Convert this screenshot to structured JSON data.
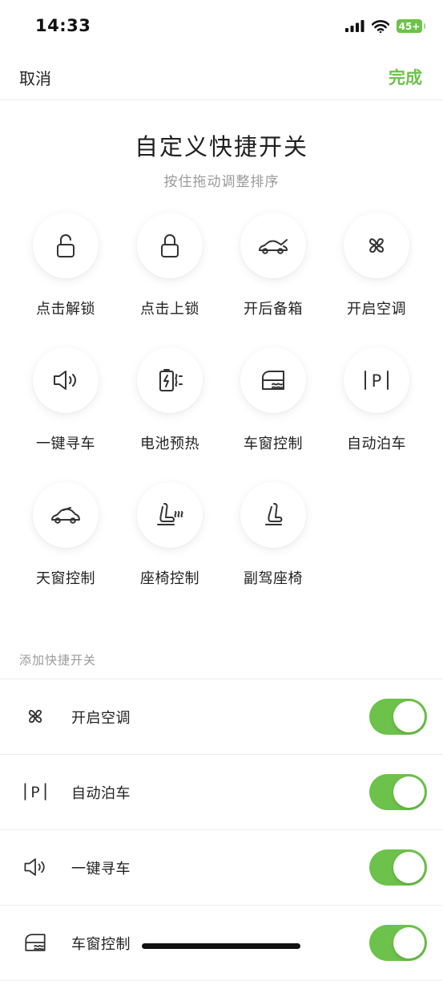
{
  "status_bar": {
    "time": "14:33",
    "battery": "45+"
  },
  "nav": {
    "cancel_label": "取消",
    "done_label": "完成"
  },
  "header": {
    "title": "自定义快捷开关",
    "subtitle": "按住拖动调整排序"
  },
  "shortcuts": [
    {
      "label": "点击解锁",
      "icon": "unlock-icon"
    },
    {
      "label": "点击上锁",
      "icon": "lock-icon"
    },
    {
      "label": "开后备箱",
      "icon": "trunk-open-icon"
    },
    {
      "label": "开启空调",
      "icon": "fan-icon"
    },
    {
      "label": "一键寻车",
      "icon": "horn-icon"
    },
    {
      "label": "电池预热",
      "icon": "battery-heat-icon"
    },
    {
      "label": "车窗控制",
      "icon": "window-icon"
    },
    {
      "label": "自动泊车",
      "icon": "parking-icon"
    },
    {
      "label": "天窗控制",
      "icon": "sunroof-icon"
    },
    {
      "label": "座椅控制",
      "icon": "seat-heat-icon"
    },
    {
      "label": "副驾座椅",
      "icon": "seat-icon"
    }
  ],
  "add_section": {
    "header": "添加快捷开关",
    "items": [
      {
        "label": "开启空调",
        "icon": "fan-icon",
        "enabled": true
      },
      {
        "label": "自动泊车",
        "icon": "parking-icon",
        "enabled": true
      },
      {
        "label": "一键寻车",
        "icon": "horn-icon",
        "enabled": true
      },
      {
        "label": "车窗控制",
        "icon": "window-icon",
        "enabled": true
      }
    ]
  },
  "colors": {
    "accent": "#6cc24a",
    "text": "#222222",
    "muted": "#9a9a9a",
    "divider": "#ececec"
  }
}
